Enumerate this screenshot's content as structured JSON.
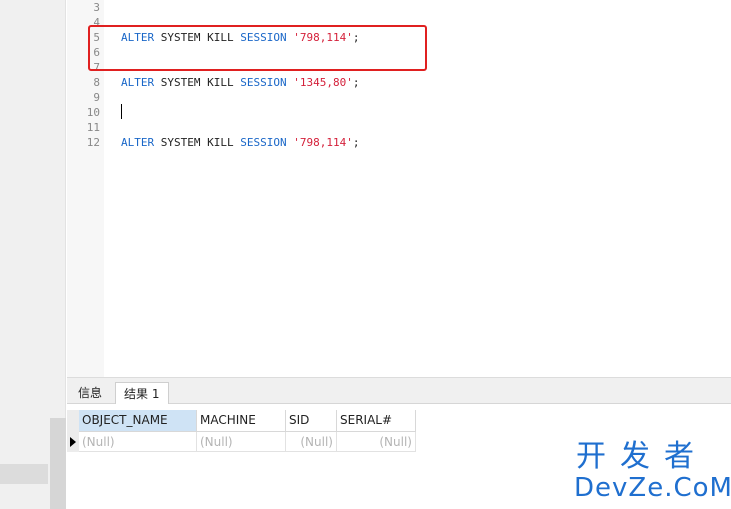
{
  "editor": {
    "lines": [
      {
        "num": "3",
        "code": null
      },
      {
        "num": "4",
        "code": null
      },
      {
        "num": "5",
        "code": {
          "kw1": "ALTER",
          "id1": "SYSTEM",
          "id2": "KILL",
          "kw2": "SESSION",
          "str": "'798,114'",
          "end": ";"
        }
      },
      {
        "num": "6",
        "code": null
      },
      {
        "num": "7",
        "code": null
      },
      {
        "num": "8",
        "code": {
          "kw1": "ALTER",
          "id1": "SYSTEM",
          "id2": "KILL",
          "kw2": "SESSION",
          "str": "'1345,80'",
          "end": ";"
        }
      },
      {
        "num": "9",
        "code": null
      },
      {
        "num": "10",
        "code": null
      },
      {
        "num": "11",
        "code": null
      },
      {
        "num": "12",
        "code": {
          "kw1": "ALTER",
          "id1": "SYSTEM",
          "id2": "KILL",
          "kw2": "SESSION",
          "str": "'798,114'",
          "end": ";"
        }
      }
    ]
  },
  "tabs": {
    "info": "信息",
    "result": "结果 1"
  },
  "grid": {
    "columns": [
      "OBJECT_NAME",
      "MACHINE",
      "SID",
      "SERIAL#"
    ],
    "row": [
      "(Null)",
      "(Null)",
      "(Null)",
      "(Null)"
    ]
  },
  "watermark": {
    "cn": "开发者",
    "en": "DevZe.CoM"
  },
  "colors": {
    "keyword": "#1a67c8",
    "string": "#d4203a",
    "highlight_box": "#e02020",
    "watermark": "#1f6fcf"
  }
}
